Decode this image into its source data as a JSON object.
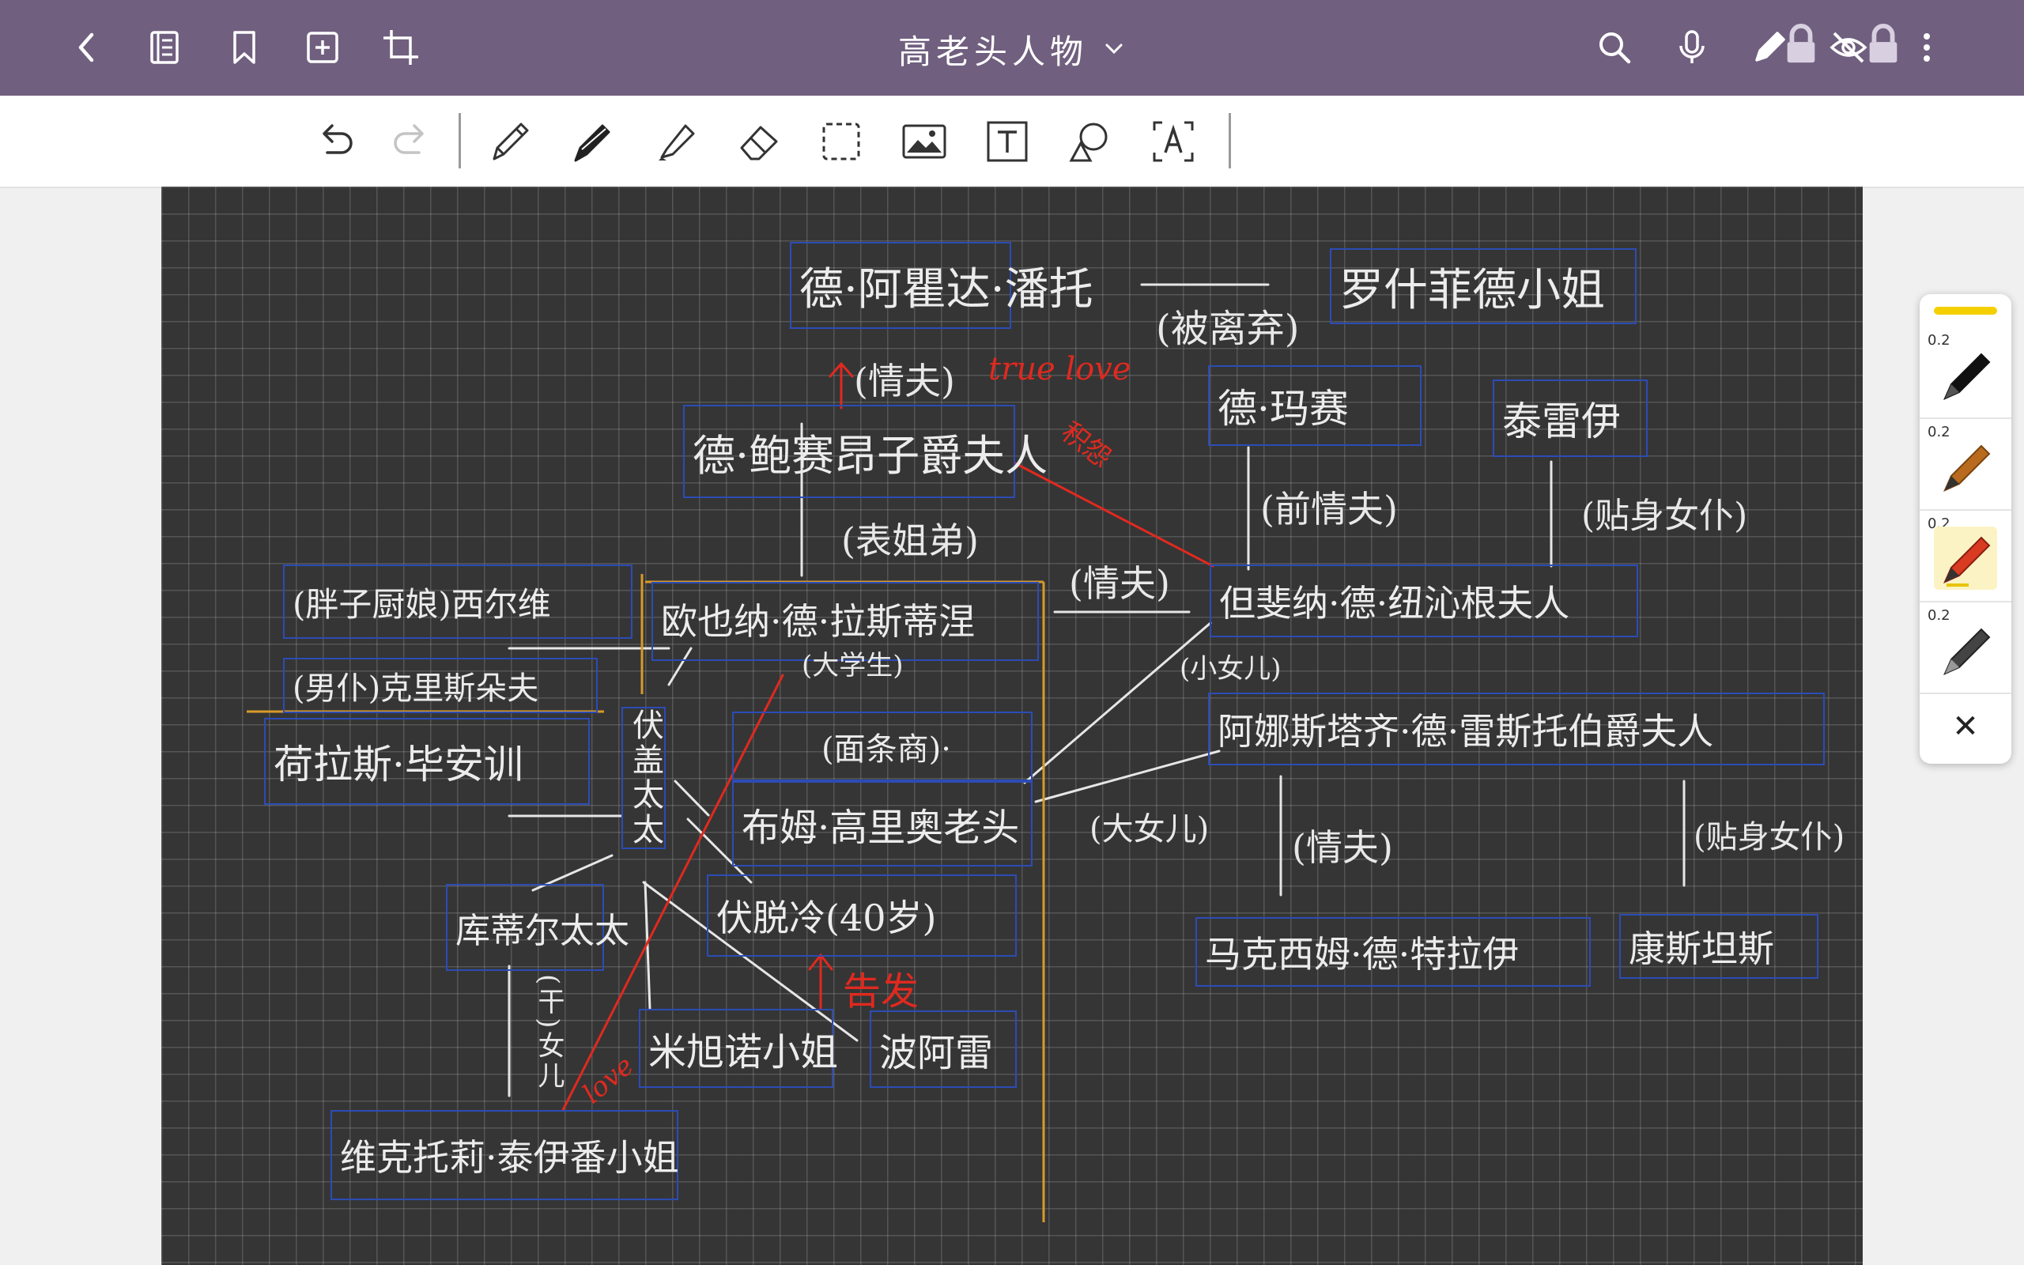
{
  "header": {
    "title": "高老头人物",
    "icons": [
      "back-icon",
      "notebook-icon",
      "bookmark-icon",
      "add-page-icon",
      "crop-icon",
      "search-icon",
      "microphone-icon",
      "pen-mode-icon",
      "hide-icon",
      "more-icon"
    ]
  },
  "colors": {
    "header_bg": "#705f7f",
    "canvas_bg": "#353535",
    "box_border": "#2c4cb5",
    "red_ink": "#e0291f",
    "orange_ink": "#d89a2a"
  },
  "toolbar": {
    "tools": [
      "undo-icon",
      "redo-icon",
      "pencil-icon",
      "fountain-pen-icon",
      "highlighter-icon",
      "eraser-icon",
      "lasso-select-icon",
      "image-icon",
      "text-box-icon",
      "shapes-icon",
      "text-recognition-icon"
    ]
  },
  "pen_panel": {
    "sizes": [
      "0.2",
      "0.2",
      "0.2",
      "0.2"
    ],
    "close": "✕"
  },
  "diagram": {
    "n_dealunda": "德·阿瞿达·潘托",
    "n_rocheflde": "罗什菲德小姐",
    "n_beauseant": "德·鲍赛昂子爵夫人",
    "n_maxime_a": "德·玛赛",
    "n_taillefer": "泰雷伊",
    "n_nucingen": "但斐纳·德·纽沁根夫人",
    "n_restaud": "阿娜斯塔齐·德·雷斯托伯爵夫人",
    "n_maxime": "马克西姆·德·特拉伊",
    "n_constantin": "康斯坦斯",
    "n_poiret_left": "(胖子厨娘)西尔维",
    "n_christophe": "(男仆)克里斯朵夫",
    "n_rastignac": "欧也纳·德·拉斯蒂涅",
    "n_rastignac_note": "(大学生)",
    "n_horace": "荷拉斯·毕安训",
    "n_vauquer": "伏盖太太",
    "n_goriot_1": "(面条商)·",
    "n_goriot_2": "布姆·高里奥老头",
    "n_vautrin": "伏脱冷(40岁)",
    "n_couture": "库蒂尔太太",
    "n_michonneau": "米旭诺小姐",
    "n_poiret": "波阿雷",
    "n_victorine": "维克托莉·泰伊番小姐",
    "l_divorce_wife": "(被离弃)",
    "l_lover_up": "(情夫)",
    "l_true_love": "true love",
    "l_old_hate": "积怨",
    "l_cousin": "(表姐弟)",
    "l_lover_mid": "(情夫)",
    "l_ex_lover": "(前情夫)",
    "l_lover_keep": "(贴身女仆)",
    "l_youngest": "(小女儿)",
    "l_eldest": "(大女儿)",
    "l_lover_max": "(情夫)",
    "l_keep2": "(贴身女仆)",
    "l_report": "告发",
    "l_goddaughter": "(干)女儿",
    "l_love": "love"
  }
}
